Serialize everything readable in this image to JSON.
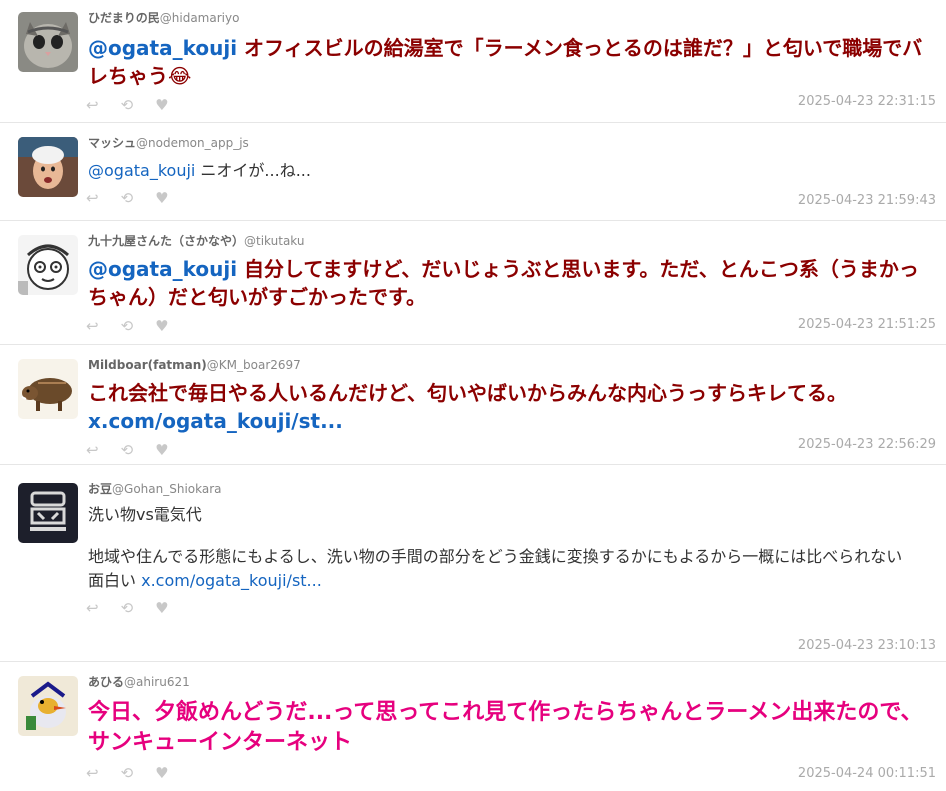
{
  "tweets": [
    {
      "display_name": "ひだまりの民",
      "handle": "@hidamariyo",
      "mention": "@ogata_kouji",
      "text": " オフィスビルの給湯室で「ラーメン食っとるのは誰だ？」と匂いで職場でバレちゃう😂",
      "timestamp": "2025-04-23 22:31:15"
    },
    {
      "display_name": "マッシュ",
      "handle": "@nodemon_app_js",
      "mention": "@ogata_kouji",
      "text": " ニオイが...ね...",
      "timestamp": "2025-04-23 21:59:43"
    },
    {
      "display_name": "九十九屋さんた（さかなや）",
      "handle": "@tikutaku",
      "mention": "@ogata_kouji",
      "text": " 自分してますけど、だいじょうぶと思います。ただ、とんこつ系（うまかっちゃん）だと匂いがすごかったです。",
      "timestamp": "2025-04-23 21:51:25"
    },
    {
      "display_name": "Mildboar(fatman)",
      "handle": "@KM_boar2697",
      "text": "これ会社で毎日やる人いるんだけど、匂いやばいからみんな内心うっすらキレてる。",
      "link": "x.com/ogata_kouji/st...",
      "timestamp": "2025-04-23 22:56:29"
    },
    {
      "display_name": "お豆",
      "handle": "@Gohan_Shiokara",
      "line1": "洗い物vs電気代",
      "line2": "地域や住んでる形態にもよるし、洗い物の手間の部分をどう金銭に変換するかにもよるから一概には比べられない",
      "line3": "面白い ",
      "link": "x.com/ogata_kouji/st...",
      "timestamp": "2025-04-23 23:10:13"
    },
    {
      "display_name": "あひる",
      "handle": "@ahiru621",
      "text": "今日、夕飯めんどうだ...って思ってこれ見て作ったらちゃんとラーメン出来たので、サンキューインターネット",
      "timestamp": "2025-04-24 00:11:51"
    }
  ],
  "icons": {
    "reply": "↩",
    "retweet": "⟲",
    "like": "♥"
  }
}
